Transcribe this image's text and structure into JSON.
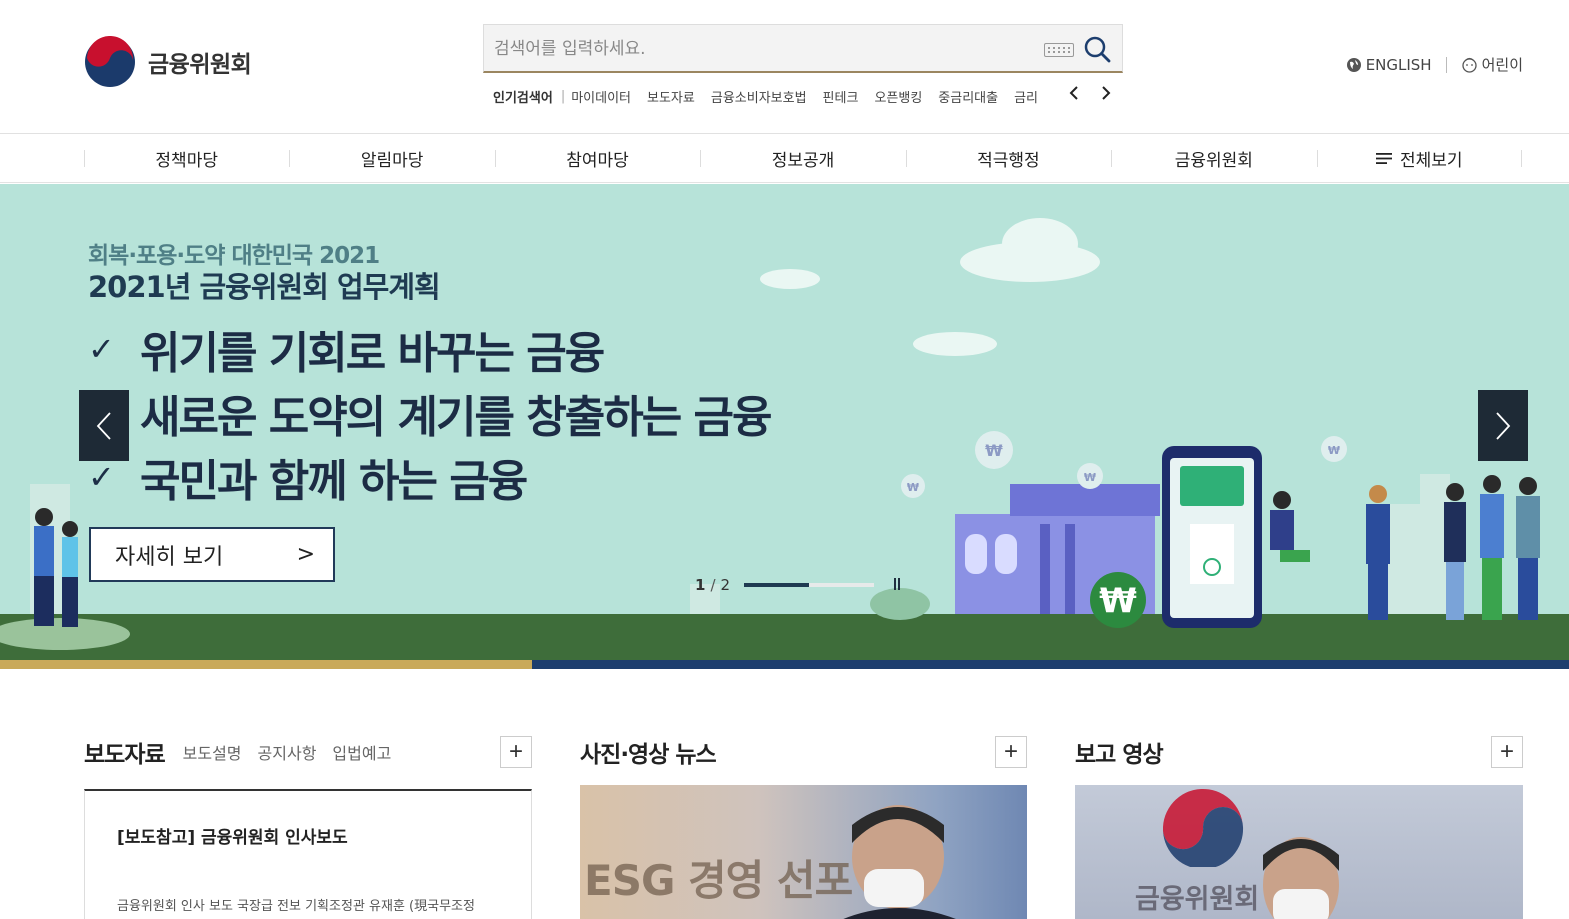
{
  "header": {
    "logo_text": "금융위원회",
    "search": {
      "placeholder": "검색어를 입력하세요."
    },
    "popular": {
      "label": "인기검색어",
      "separator": "|",
      "items": [
        "마이데이터",
        "보도자료",
        "금융소비자보호법",
        "핀테크",
        "오픈뱅킹",
        "중금리대출",
        "금리"
      ],
      "prev_icon": "chevron-left-icon",
      "next_icon": "chevron-right-icon"
    },
    "util": {
      "english": "ENGLISH",
      "kids": "어린이"
    }
  },
  "gnb": [
    "정책마당",
    "알림마당",
    "참여마당",
    "정보공개",
    "적극행정",
    "금융위원회",
    "전체보기"
  ],
  "banner": {
    "subtitle": "회복·포용·도약 대한민국 2021",
    "title": "2021년 금융위원회 업무계획",
    "check_mark": "✓",
    "points": [
      "위기를 기회로 바꾸는 금융",
      "새로운 도약의 계기를 창출하는 금융",
      "국민과 함께 하는 금융"
    ],
    "detail_button": "자세히 보기",
    "detail_arrow": ">",
    "pager": {
      "current": "1",
      "separator": "/",
      "total": "2",
      "progress": 0.5
    },
    "colors": {
      "sky": "#b7e3d9",
      "ground": "#3e6d3a",
      "gold": "#c9a95a",
      "navy": "#1d3e6e"
    }
  },
  "sections": {
    "press": {
      "title": "보도자료",
      "tabs": [
        "보도설명",
        "공지사항",
        "입법예고"
      ],
      "more": "+",
      "item_title": "[보도참고] 금융위원회 인사보도",
      "item_desc": "금융위원회 인사 보도 국장급 전보 기획조정관 유재훈 (現국무조정"
    },
    "photo": {
      "title": "사진·영상 뉴스",
      "more": "+",
      "image_text": "ESG 경영 선포"
    },
    "video": {
      "title": "보고 영상",
      "more": "+",
      "image_text": "금융위원회"
    }
  }
}
